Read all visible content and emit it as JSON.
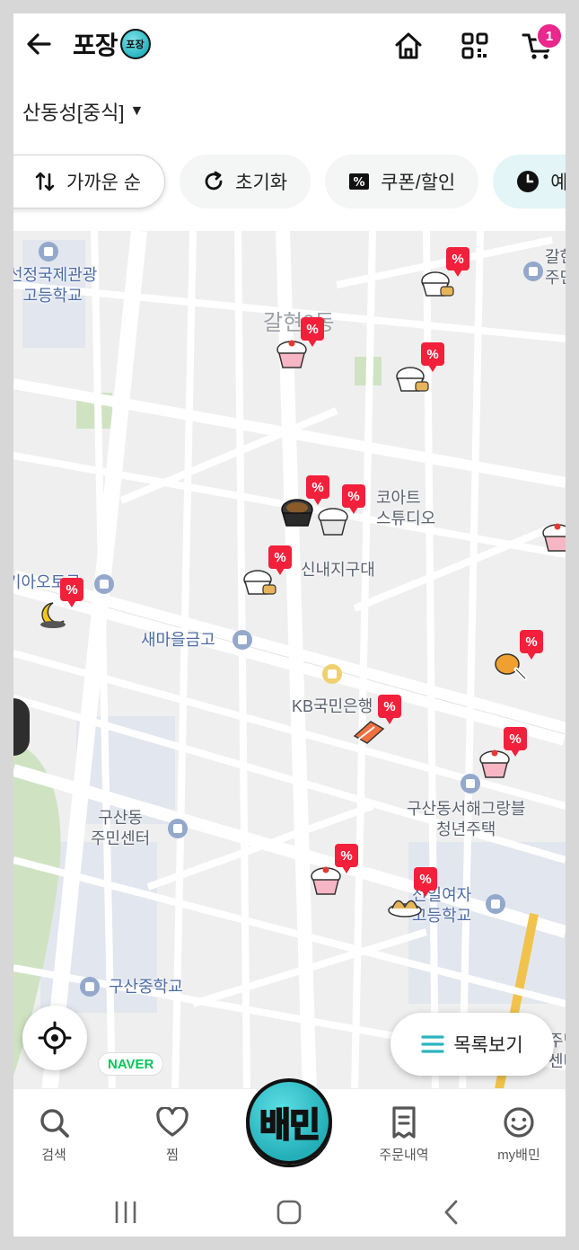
{
  "header": {
    "logo_text": "포장",
    "logo_badge": "포장",
    "cart_count": "1"
  },
  "location": {
    "label": "산동성[중식]"
  },
  "filters": [
    {
      "label": "가까운 순",
      "icon": "sort-icon"
    },
    {
      "label": "초기화",
      "icon": "refresh-icon"
    },
    {
      "label": "쿠폰/할인",
      "icon": "coupon-icon"
    },
    {
      "label": "예약",
      "icon": "clock-icon"
    }
  ],
  "map": {
    "districts": [
      "갈현2동"
    ],
    "pois": [
      {
        "name": "선정국제관광\n고등학교"
      },
      {
        "name": "코아트\n스튜디오"
      },
      {
        "name": "신내지구대"
      },
      {
        "name": "기아오토큐"
      },
      {
        "name": "새마을금고"
      },
      {
        "name": "KB국민은행"
      },
      {
        "name": "구산동서해그랑블\n청년주택"
      },
      {
        "name": "구산동\n주민센터"
      },
      {
        "name": "선일여자\n고등학교"
      },
      {
        "name": "구산중학교"
      },
      {
        "name": "갈현\n주민"
      },
      {
        "name": "주민\n센터"
      }
    ],
    "markers": [
      "rice-tofu-marker",
      "cupcake-marker",
      "rice-tofu-marker",
      "black-noodle-marker",
      "cupcake-marker",
      "rice-tofu-marker",
      "moon-night-marker",
      "chicken-leg-marker",
      "sushi-marker",
      "cupcake-marker",
      "cupcake-marker",
      "dumpling-marker",
      "cupcake-marker"
    ],
    "naver_label": "NAVER",
    "list_button_label": "목록보기"
  },
  "bottom_nav": {
    "items": [
      {
        "label": "검색",
        "icon": "search-icon"
      },
      {
        "label": "찜",
        "icon": "heart-icon"
      },
      {
        "label": "배민",
        "icon": "baemin-logo"
      },
      {
        "label": "주문내역",
        "icon": "receipt-icon"
      },
      {
        "label": "my배민",
        "icon": "smile-icon"
      }
    ]
  },
  "colors": {
    "accent_teal": "#2ab5bf",
    "badge_pink": "#e9278c",
    "discount_red": "#f2203a",
    "naver_green": "#03c75a"
  }
}
